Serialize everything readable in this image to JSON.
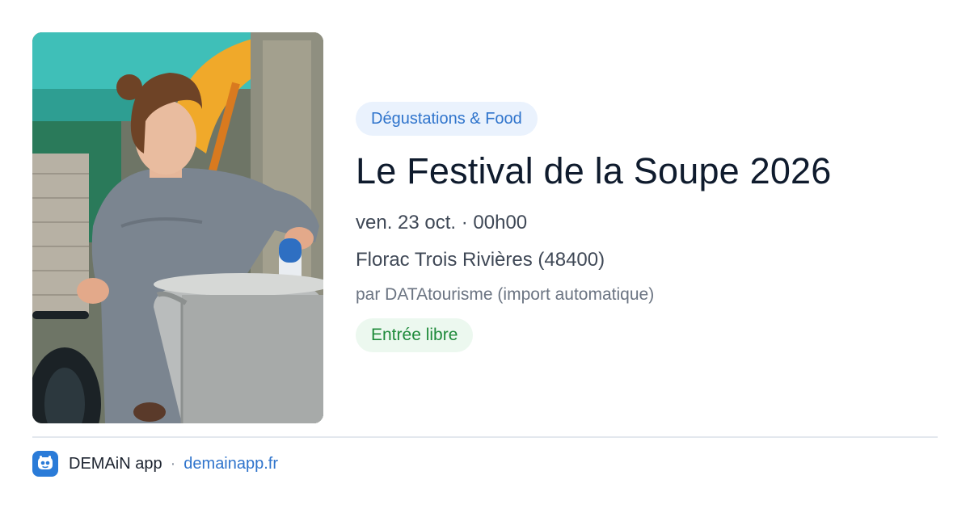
{
  "event": {
    "category": "Dégustations & Food",
    "title": "Le Festival de la Soupe 2026",
    "datetime": "ven. 23 oct. · 00h00",
    "location": "Florac Trois Rivières (48400)",
    "organizer": "par DATAtourisme (import automatique)",
    "price": "Entrée libre",
    "image_alt": "Femme remuant une grande marmite de soupe lors d'un festival en plein air"
  },
  "footer": {
    "app_name": "DEMAiN app",
    "separator": "·",
    "url": "demainapp.fr",
    "icon": "demain-app-logo-icon"
  },
  "colors": {
    "accent_blue": "#2f74cc",
    "category_bg": "#eaf2fd",
    "price_green": "#1e8a3a",
    "price_bg": "#ecf8ef",
    "title": "#0f1b2d"
  }
}
